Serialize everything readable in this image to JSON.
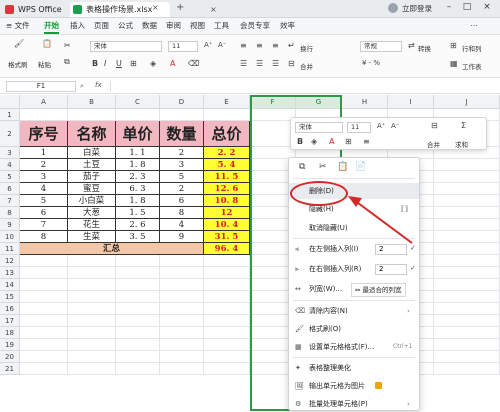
{
  "titlebar": {
    "app_tab": "WPS Office",
    "doc_tab": "表格操作场景.xlsx",
    "new_tab": "+",
    "login": "立即登录"
  },
  "menubar": {
    "file": "≡ 文件",
    "items": [
      "开始",
      "插入",
      "页面",
      "公式",
      "数据",
      "审阅",
      "视图",
      "工具",
      "会员专享",
      "效率"
    ]
  },
  "ribbon": {
    "format_painter": "格式刷",
    "paste": "粘贴",
    "font_name": "宋体",
    "font_size": "11",
    "wrap": "换行",
    "merge": "合并",
    "number_format": "常规",
    "convert": "转换",
    "rows_cols": "行和列",
    "worksheet": "工作表"
  },
  "formulabar": {
    "namebox": "F1",
    "fx": "fx"
  },
  "columns": [
    "A",
    "B",
    "C",
    "D",
    "E",
    "F",
    "G",
    "H",
    "I",
    "J"
  ],
  "rows": [
    "1",
    "2",
    "3",
    "4",
    "5",
    "6",
    "7",
    "8",
    "9",
    "10",
    "11",
    "12",
    "13",
    "14",
    "15",
    "16",
    "17",
    "18",
    "19",
    "20",
    "21"
  ],
  "table": {
    "headers": [
      "序号",
      "名称",
      "单价",
      "数量",
      "总价"
    ],
    "data": [
      [
        "1",
        "白菜",
        "1. 1",
        "2",
        "2. 2"
      ],
      [
        "2",
        "土豆",
        "1. 8",
        "3",
        "5. 4"
      ],
      [
        "3",
        "茄子",
        "2. 3",
        "5",
        "11. 5"
      ],
      [
        "4",
        "蜜豆",
        "6. 3",
        "2",
        "12. 6"
      ],
      [
        "5",
        "小白菜",
        "1. 8",
        "6",
        "10. 8"
      ],
      [
        "6",
        "大葱",
        "1. 5",
        "8",
        "12"
      ],
      [
        "7",
        "花生",
        "2. 6",
        "4",
        "10. 4"
      ],
      [
        "8",
        "生菜",
        "3. 5",
        "9",
        "31. 5"
      ]
    ],
    "total_label": "汇总",
    "total_value": "96. 4"
  },
  "mini_toolbar": {
    "font_name": "宋体",
    "font_size": "11",
    "merge": "合并",
    "sum": "求和"
  },
  "context_menu": {
    "delete": "删除(D)",
    "hide": "隐藏(H)",
    "unhide": "取消隐藏(U)",
    "insert_left": "在左侧插入列(I)",
    "insert_left_count": "2",
    "insert_right": "在右侧插入列(R)",
    "insert_right_count": "2",
    "col_width": "列宽(W)...",
    "best_fit": "最适合的列宽",
    "clear": "清除内容(N)",
    "format_brush": "格式刷(O)",
    "cell_format": "设置单元格格式(F)...",
    "cell_format_shortcut": "Ctrl+1",
    "beautify": "表格整理美化",
    "export_image": "输出单元格为图片",
    "batch": "批量处理单元格(P)"
  },
  "colors": {
    "accent": "#0f9d3a",
    "header_fill": "#f2b8c2",
    "total_fill": "#f3c8a8",
    "highlight_yellow": "#ffff33",
    "annotation_red": "#d22a2a"
  }
}
